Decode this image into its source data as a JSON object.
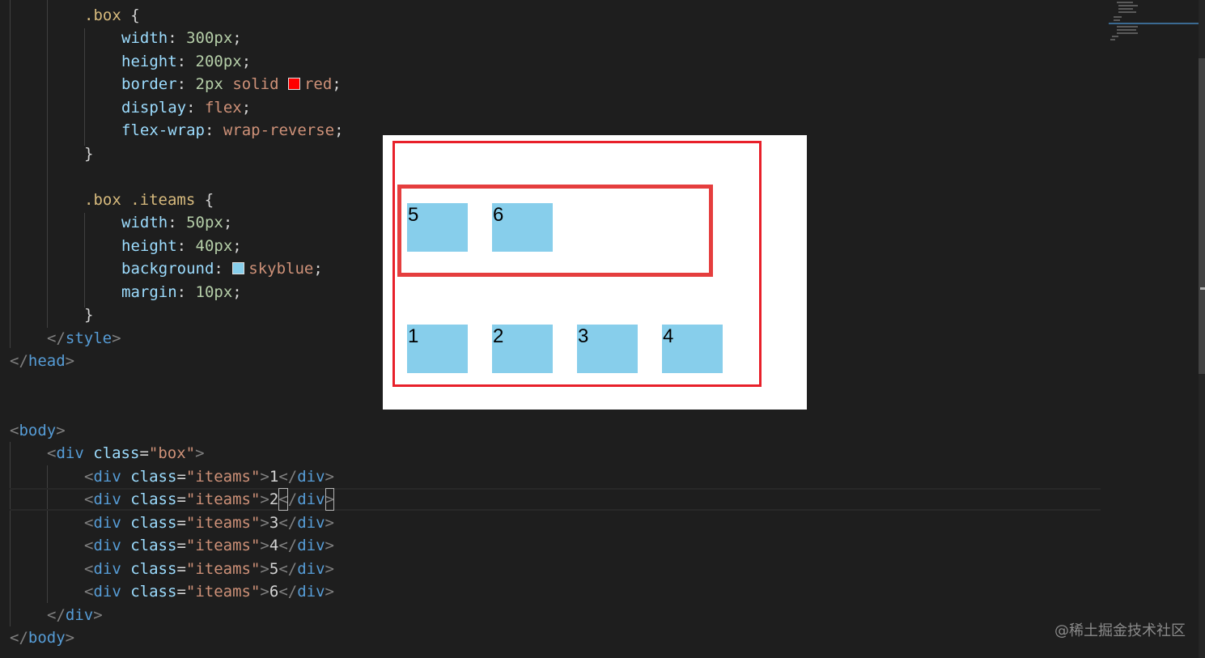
{
  "code": {
    "box_selector": ".box",
    "open_brace": "{",
    "close_brace": "}",
    "semicolon": ";",
    "box_rules": [
      {
        "prop": "width",
        "value": "300px",
        "kind": "num"
      },
      {
        "prop": "height",
        "value": "200px",
        "kind": "num"
      },
      {
        "prop": "border",
        "value_num": "2px",
        "value_kw": "solid",
        "color_name": "red",
        "swatch": "#ff0000"
      },
      {
        "prop": "display",
        "value": "flex",
        "kind": "val"
      },
      {
        "prop": "flex-wrap",
        "value": "wrap-reverse",
        "kind": "val"
      }
    ],
    "item_selector_a": ".box",
    "item_selector_b": ".iteams",
    "item_rules": [
      {
        "prop": "width",
        "value": "50px",
        "kind": "num"
      },
      {
        "prop": "height",
        "value": "40px",
        "kind": "num"
      },
      {
        "prop": "background",
        "color_name": "skyblue",
        "swatch": "#87ceeb"
      },
      {
        "prop": "margin",
        "value": "10px",
        "kind": "num"
      }
    ],
    "style_tag": "style",
    "head_tag": "head",
    "body_tag": "body",
    "div_tag": "div",
    "attr_class": "class",
    "box_class": "\"box\"",
    "item_class": "\"iteams\"",
    "children": [
      "1",
      "2",
      "3",
      "4",
      "5",
      "6"
    ]
  },
  "preview": {
    "items_top_row": [
      "5",
      "6"
    ],
    "items_bottom_row": [
      "1",
      "2",
      "3",
      "4"
    ],
    "border_color": "#e8202a",
    "item_color": "#87ceeb"
  },
  "watermark": "@稀土掘金技术社区"
}
